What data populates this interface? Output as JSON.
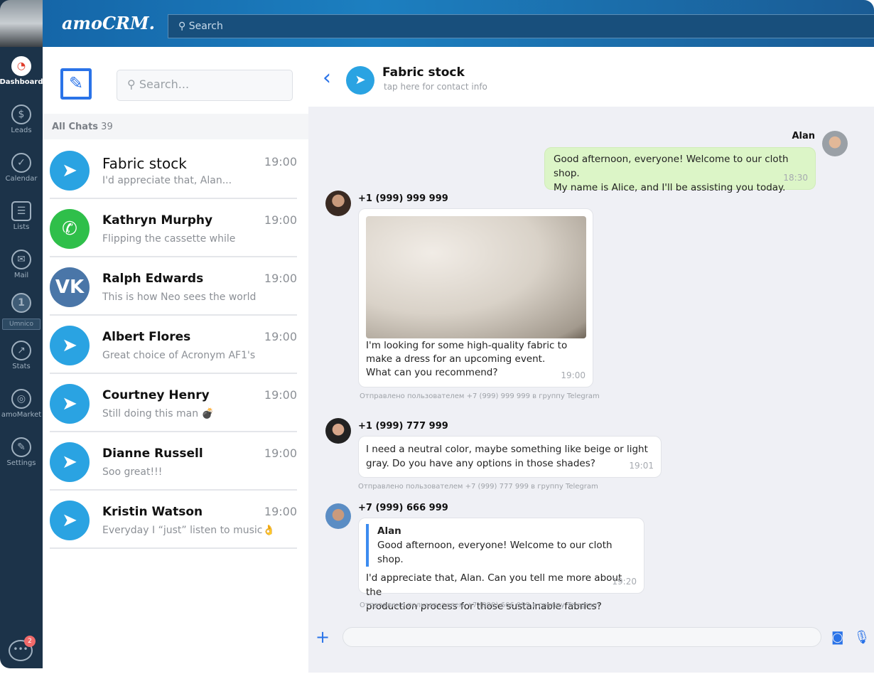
{
  "sidebar": {
    "items": [
      {
        "label": "Dashboard",
        "icon": "dashboard-icon"
      },
      {
        "label": "Leads",
        "icon": "dollar-icon"
      },
      {
        "label": "Calendar",
        "icon": "check-icon"
      },
      {
        "label": "Lists",
        "icon": "list-icon"
      },
      {
        "label": "Mail",
        "icon": "mail-icon"
      }
    ],
    "umnico": {
      "count": "1",
      "label": "Umnico"
    },
    "items2": [
      {
        "label": "Stats",
        "icon": "stats-icon"
      },
      {
        "label": "amoMarket",
        "icon": "market-icon"
      },
      {
        "label": "Settings",
        "icon": "wrench-icon"
      }
    ],
    "chat_badge": "2"
  },
  "topbar": {
    "logo": "amoCRM.",
    "search_placeholder": "Search"
  },
  "chatlist": {
    "search_placeholder": "Search...",
    "all_chats_label": "All Chats",
    "all_chats_count": "39",
    "items": [
      {
        "name": "Fabric stock",
        "preview": "I'd appreciate that, Alan...",
        "time": "19:00",
        "channel": "telegram"
      },
      {
        "name": "Kathryn Murphy",
        "preview": "Flipping the cassette while",
        "time": "19:00",
        "channel": "whatsapp"
      },
      {
        "name": "Ralph Edwards",
        "preview": "This is how Neo sees the world",
        "time": "19:00",
        "channel": "vk"
      },
      {
        "name": "Albert Flores",
        "preview": "Great choice of Acronym AF1's",
        "time": "19:00",
        "channel": "telegram"
      },
      {
        "name": "Courtney Henry",
        "preview": "Still doing this man 💣",
        "time": "19:00",
        "channel": "telegram"
      },
      {
        "name": "Dianne Russell",
        "preview": "Soo great!!!",
        "time": "19:00",
        "channel": "telegram"
      },
      {
        "name": "Kristin Watson",
        "preview": "Everyday I “just” listen to music👌",
        "time": "19:00",
        "channel": "telegram"
      }
    ]
  },
  "chat": {
    "title": "Fabric stock",
    "subtitle": "tap here for contact info",
    "messages": [
      {
        "sender": "Alan",
        "text1": "Good afternoon, everyone! Welcome to our cloth shop.",
        "text2": "My name is Alice, and I'll be assisting you today.",
        "time": "18:30"
      },
      {
        "sender": "+1 (999) 999 999",
        "text1": "I'm looking for some high-quality fabric to",
        "text2": "make a dress for an upcoming event.",
        "text3": "What can you recommend?",
        "time": "19:00",
        "note": "Отправлено пользователем +7 (999) 999 999 в группу Telegram"
      },
      {
        "sender": "+1 (999) 777 999",
        "text1": "I need a neutral color, maybe something like beige or light",
        "text2": "gray. Do you have any options in those shades?",
        "time": "19:01",
        "note": "Отправлено пользователем +7 (999) 777 999 в группу Telegram"
      },
      {
        "sender": "+7 (999) 666 999",
        "quote_author": "Alan",
        "quote_text": "Good afternoon, everyone! Welcome to our cloth shop.",
        "text1": "I'd appreciate that, Alan. Can you tell me more about the",
        "text2": "production process for those sustainable fabrics?",
        "time": "19:20",
        "note": "Отправлено пользователем +7 (999) 666 999 в группу Telegram"
      }
    ]
  },
  "colors": {
    "accent": "#2a73e8",
    "sidebar": "#1c3349",
    "telegram": "#2aa3e2",
    "whatsapp": "#2fbf4a",
    "vk": "#4a76a8",
    "own_bubble": "#dcf5c7"
  }
}
